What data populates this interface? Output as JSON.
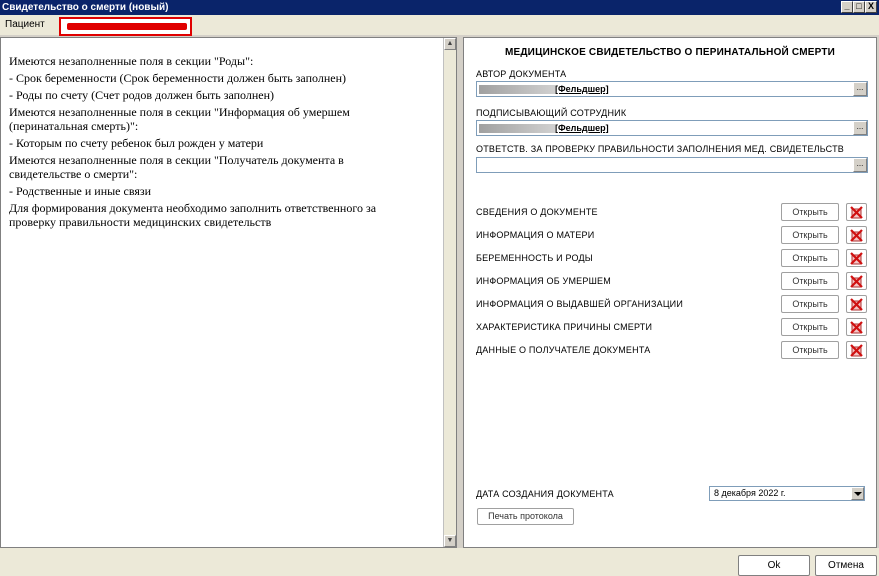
{
  "window": {
    "title": "Свидетельство о смерти (новый)",
    "controls": [
      "_",
      "□",
      "X"
    ]
  },
  "patient": {
    "label": "Пациент",
    "highlight_color": "#e00000"
  },
  "messages": [
    "Имеются незаполненные поля в секции \"Роды\":",
    "- Срок беременности (Срок беременности должен быть заполнен)",
    "- Роды по счету (Счет родов должен быть заполнен)",
    "Имеются незаполненные поля в секции \"Информация об умершем (перинатальная смерть)\":",
    "- Которым по счету ребенок был рожден у матери",
    "Имеются незаполненные поля в секции \"Получатель документа в свидетельстве о смерти\":",
    "- Родственные и иные связи",
    "Для формирования документа необходимо заполнить ответственного за проверку правильности медицинских свидетельств"
  ],
  "form": {
    "title": "МЕДИЦИНСКОЕ СВИДЕТЕЛЬСТВО О ПЕРИНАТАЛЬНОЙ СМЕРТИ",
    "author_label": "АВТОР ДОКУМЕНТА",
    "author_value": "[Фельдшер]",
    "signer_label": "ПОДПИСЫВАЮЩИЙ СОТРУДНИК",
    "signer_value": "[Фельдшер]",
    "responsible_label": "ОТВЕТСТВ. ЗА ПРОВЕРКУ ПРАВИЛЬНОСТИ ЗАПОЛНЕНИЯ МЕД. СВИДЕТЕЛЬСТВ",
    "lookup_button": "...",
    "open_label": "Открыть",
    "sections": [
      "СВЕДЕНИЯ О ДОКУМЕНТЕ",
      "ИНФОРМАЦИЯ О МАТЕРИ",
      "БЕРЕМЕННОСТЬ И РОДЫ",
      "ИНФОРМАЦИЯ ОБ УМЕРШЕМ",
      "ИНФОРМАЦИЯ О ВЫДАВШЕЙ ОРГАНИЗАЦИИ",
      "ХАРАКТЕРИСТИКА ПРИЧИНЫ СМЕРТИ",
      "ДАННЫЕ О ПОЛУЧАТЕЛЕ ДОКУМЕНТА"
    ],
    "date_label": "ДАТА СОЗДАНИЯ ДОКУМЕНТА",
    "date_value": "8 декабря 2022 г.",
    "print_button": "Печать протокола"
  },
  "footer": {
    "ok": "Ok",
    "cancel": "Отмена"
  }
}
